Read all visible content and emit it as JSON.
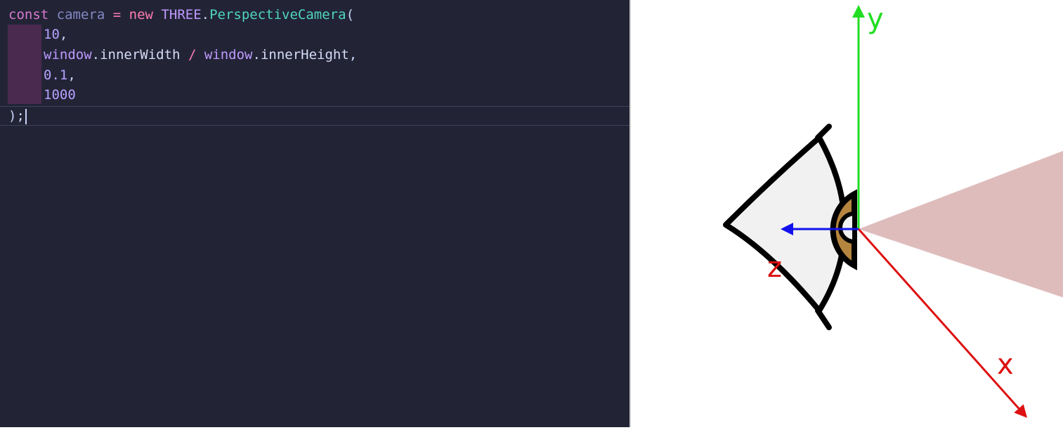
{
  "editor": {
    "background": "#222436",
    "lines": [
      [
        {
          "t": "const",
          "c": "tok-kw"
        },
        {
          "t": " ",
          "c": "tok-pun"
        },
        {
          "t": "camera",
          "c": "tok-var"
        },
        {
          "t": " ",
          "c": "tok-pun"
        },
        {
          "t": "=",
          "c": "tok-op"
        },
        {
          "t": " ",
          "c": "tok-pun"
        },
        {
          "t": "new",
          "c": "tok-op"
        },
        {
          "t": " ",
          "c": "tok-pun"
        },
        {
          "t": "THREE",
          "c": "tok-cls"
        },
        {
          "t": ".",
          "c": "tok-pun"
        },
        {
          "t": "PerspectiveCamera",
          "c": "tok-fn"
        },
        {
          "t": "(",
          "c": "tok-pun"
        }
      ],
      [
        {
          "t": "10",
          "c": "tok-num"
        },
        {
          "t": ",",
          "c": "tok-pun"
        }
      ],
      [
        {
          "t": "window",
          "c": "tok-cls"
        },
        {
          "t": ".",
          "c": "tok-pun"
        },
        {
          "t": "innerWidth",
          "c": "tok-prop"
        },
        {
          "t": " ",
          "c": "tok-pun"
        },
        {
          "t": "/",
          "c": "tok-op"
        },
        {
          "t": " ",
          "c": "tok-pun"
        },
        {
          "t": "window",
          "c": "tok-cls"
        },
        {
          "t": ".",
          "c": "tok-pun"
        },
        {
          "t": "innerHeight",
          "c": "tok-prop"
        },
        {
          "t": ",",
          "c": "tok-pun"
        }
      ],
      [
        {
          "t": "0.1",
          "c": "tok-num"
        },
        {
          "t": ",",
          "c": "tok-pun"
        }
      ],
      [
        {
          "t": "1000",
          "c": "tok-num"
        }
      ],
      [
        {
          "t": ");",
          "c": "tok-pun"
        }
      ]
    ]
  },
  "diagram": {
    "axes": {
      "y": {
        "label": "y",
        "color": "#22dd22"
      },
      "x": {
        "label": "x",
        "color": "#dd1111"
      },
      "z": {
        "label": "z",
        "color": "#1111ee",
        "label_color": "#dd1111"
      }
    },
    "colors": {
      "frustum": "#dfbcbc",
      "eye_fill": "#f1f1f1",
      "iris": "#b5843e",
      "outline": "#000000"
    },
    "icons": [
      "eye-icon"
    ]
  }
}
